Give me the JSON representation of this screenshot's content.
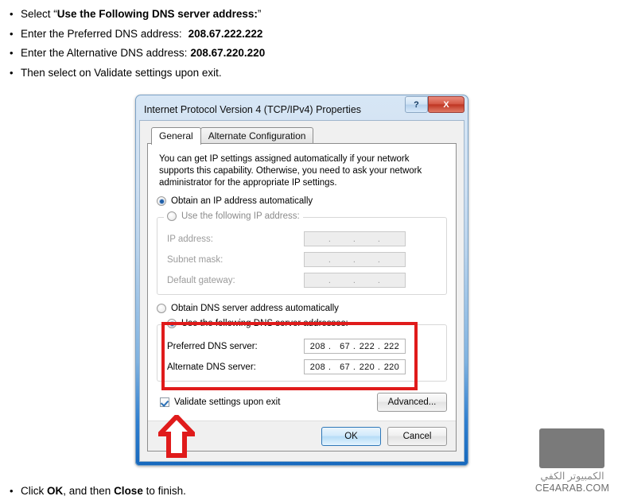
{
  "instructions": {
    "bullet_char": "•",
    "items": [
      {
        "prefix": "Select “",
        "bold": "Use the Following DNS server address:",
        "suffix": "”"
      },
      {
        "prefix": "Enter the Preferred DNS address:",
        "bold": "208.67.222.222",
        "suffix": ""
      },
      {
        "prefix": "Enter the Alternative DNS address:",
        "bold": "208.67.220.220",
        "suffix": ""
      },
      {
        "prefix": "Then select on Validate settings upon exit.",
        "bold": "",
        "suffix": ""
      }
    ]
  },
  "footer": {
    "prefix": "Click ",
    "bold1": "OK",
    "middle": ", and then ",
    "bold2": "Close",
    "suffix": " to finish."
  },
  "dialog": {
    "title": "Internet Protocol Version 4 (TCP/IPv4) Properties",
    "help_button": "?",
    "close_button": "X",
    "tabs": [
      {
        "label": "General",
        "active": true
      },
      {
        "label": "Alternate Configuration",
        "active": false
      }
    ],
    "description": "You can get IP settings assigned automatically if your network supports this capability. Otherwise, you need to ask your network administrator for the appropriate IP settings.",
    "ip_section": {
      "auto_radio_label": "Obtain an IP address automatically",
      "manual_radio_label": "Use the following IP address:",
      "fields": [
        {
          "label": "IP address:",
          "octets": [
            "",
            "",
            "",
            ""
          ]
        },
        {
          "label": "Subnet mask:",
          "octets": [
            "",
            "",
            "",
            ""
          ]
        },
        {
          "label": "Default gateway:",
          "octets": [
            "",
            "",
            "",
            ""
          ]
        }
      ]
    },
    "dns_section": {
      "auto_radio_label": "Obtain DNS server address automatically",
      "manual_radio_label": "Use the following DNS server addresses:",
      "fields": [
        {
          "label": "Preferred DNS server:",
          "octets": [
            "208",
            "67",
            "222",
            "222"
          ]
        },
        {
          "label": "Alternate DNS server:",
          "octets": [
            "208",
            "67",
            "220",
            "220"
          ]
        }
      ]
    },
    "validate_checkbox_label": "Validate settings upon exit",
    "advanced_button": "Advanced...",
    "ok_button": "OK",
    "cancel_button": "Cancel",
    "separator": "."
  },
  "annotations": {
    "highlight_color": "#e01b1b",
    "arrow_color": "#e01b1b"
  },
  "watermark": {
    "arabic": "الكمبيوتر الكفي",
    "domain": "CE4ARAB.COM"
  }
}
